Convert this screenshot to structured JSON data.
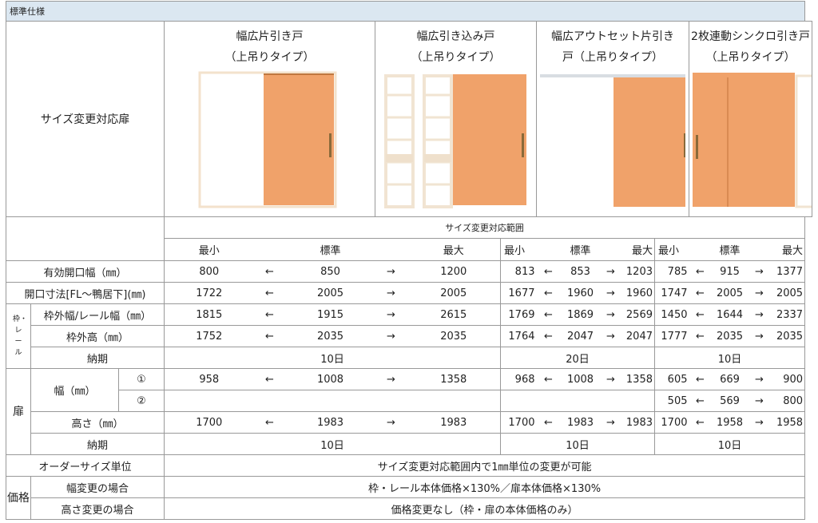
{
  "section_title": "標準仕様",
  "row_label_doors": "サイズ変更対応扉",
  "products": [
    {
      "title_line1": "幅広片引き戸",
      "title_line2": "（上吊りタイプ）"
    },
    {
      "title_line1": "幅広引き込み戸",
      "title_line2": "（上吊りタイプ）"
    },
    {
      "title_line1": "幅広アウトセット片引き",
      "title_line2": "戸（上吊りタイプ）"
    },
    {
      "title_line1": "2枚連動シンクロ引き戸",
      "title_line2": "（上吊りタイプ）"
    }
  ],
  "range_header": "サイズ変更対応範囲",
  "col_min": "最小",
  "col_std": "標準",
  "col_max": "最大",
  "arrow_left": "←",
  "arrow_right": "→",
  "labels": {
    "effective_width": "有効開口幅（㎜）",
    "opening": "開口寸法[FL～鴨居下](㎜)",
    "frame_group": "枠・レール",
    "frame_width": "枠外幅/レール幅（㎜）",
    "frame_height": "枠外高（㎜）",
    "lead_time": "納期",
    "door_group": "扉",
    "door_width": "幅（㎜）",
    "circle1": "①",
    "circle2": "②",
    "door_height": "高さ（㎜）",
    "order_unit": "オーダーサイズ単位",
    "price_group": "価格",
    "width_change": "幅変更の場合",
    "height_change": "高さ変更の場合"
  },
  "rows": {
    "effective_width": {
      "p12": [
        "800",
        "850",
        "1200"
      ],
      "p3": [
        "813",
        "853",
        "1203"
      ],
      "p4": [
        "785",
        "915",
        "1377"
      ]
    },
    "opening": {
      "p12": [
        "1722",
        "2005",
        "2005"
      ],
      "p3": [
        "1677",
        "1960",
        "1960"
      ],
      "p4": [
        "1747",
        "2005",
        "2005"
      ]
    },
    "frame_width": {
      "p12": [
        "1815",
        "1915",
        "2615"
      ],
      "p3": [
        "1769",
        "1869",
        "2569"
      ],
      "p4": [
        "1450",
        "1644",
        "2337"
      ]
    },
    "frame_height": {
      "p12": [
        "1752",
        "2035",
        "2035"
      ],
      "p3": [
        "1764",
        "2047",
        "2047"
      ],
      "p4": [
        "1777",
        "2035",
        "2035"
      ]
    },
    "frame_lead": {
      "p12": "10日",
      "p3": "20日",
      "p4": "10日"
    },
    "door_width1": {
      "p12": [
        "958",
        "1008",
        "1358"
      ],
      "p3": [
        "968",
        "1008",
        "1358"
      ],
      "p4": [
        "605",
        "669",
        "900"
      ]
    },
    "door_width2": {
      "p4": [
        "505",
        "569",
        "800"
      ]
    },
    "door_height": {
      "p12": [
        "1700",
        "1983",
        "1983"
      ],
      "p3": [
        "1700",
        "1983",
        "1983"
      ],
      "p4": [
        "1700",
        "1958",
        "1958"
      ]
    },
    "door_lead": {
      "p12": "10日",
      "p3": "10日",
      "p4": "10日"
    }
  },
  "order_unit_text": "サイズ変更対応範囲内で1㎜単位の変更が可能",
  "width_change_text": "枠・レール本体価格×130%／扉本体価格×130%",
  "height_change_text": "価格変更なし（枠・扉の本体価格のみ）",
  "colors": {
    "header_bg": "#dbe7f1",
    "door_wood": "#f0a26a",
    "frame_light": "#f3e7d6"
  }
}
